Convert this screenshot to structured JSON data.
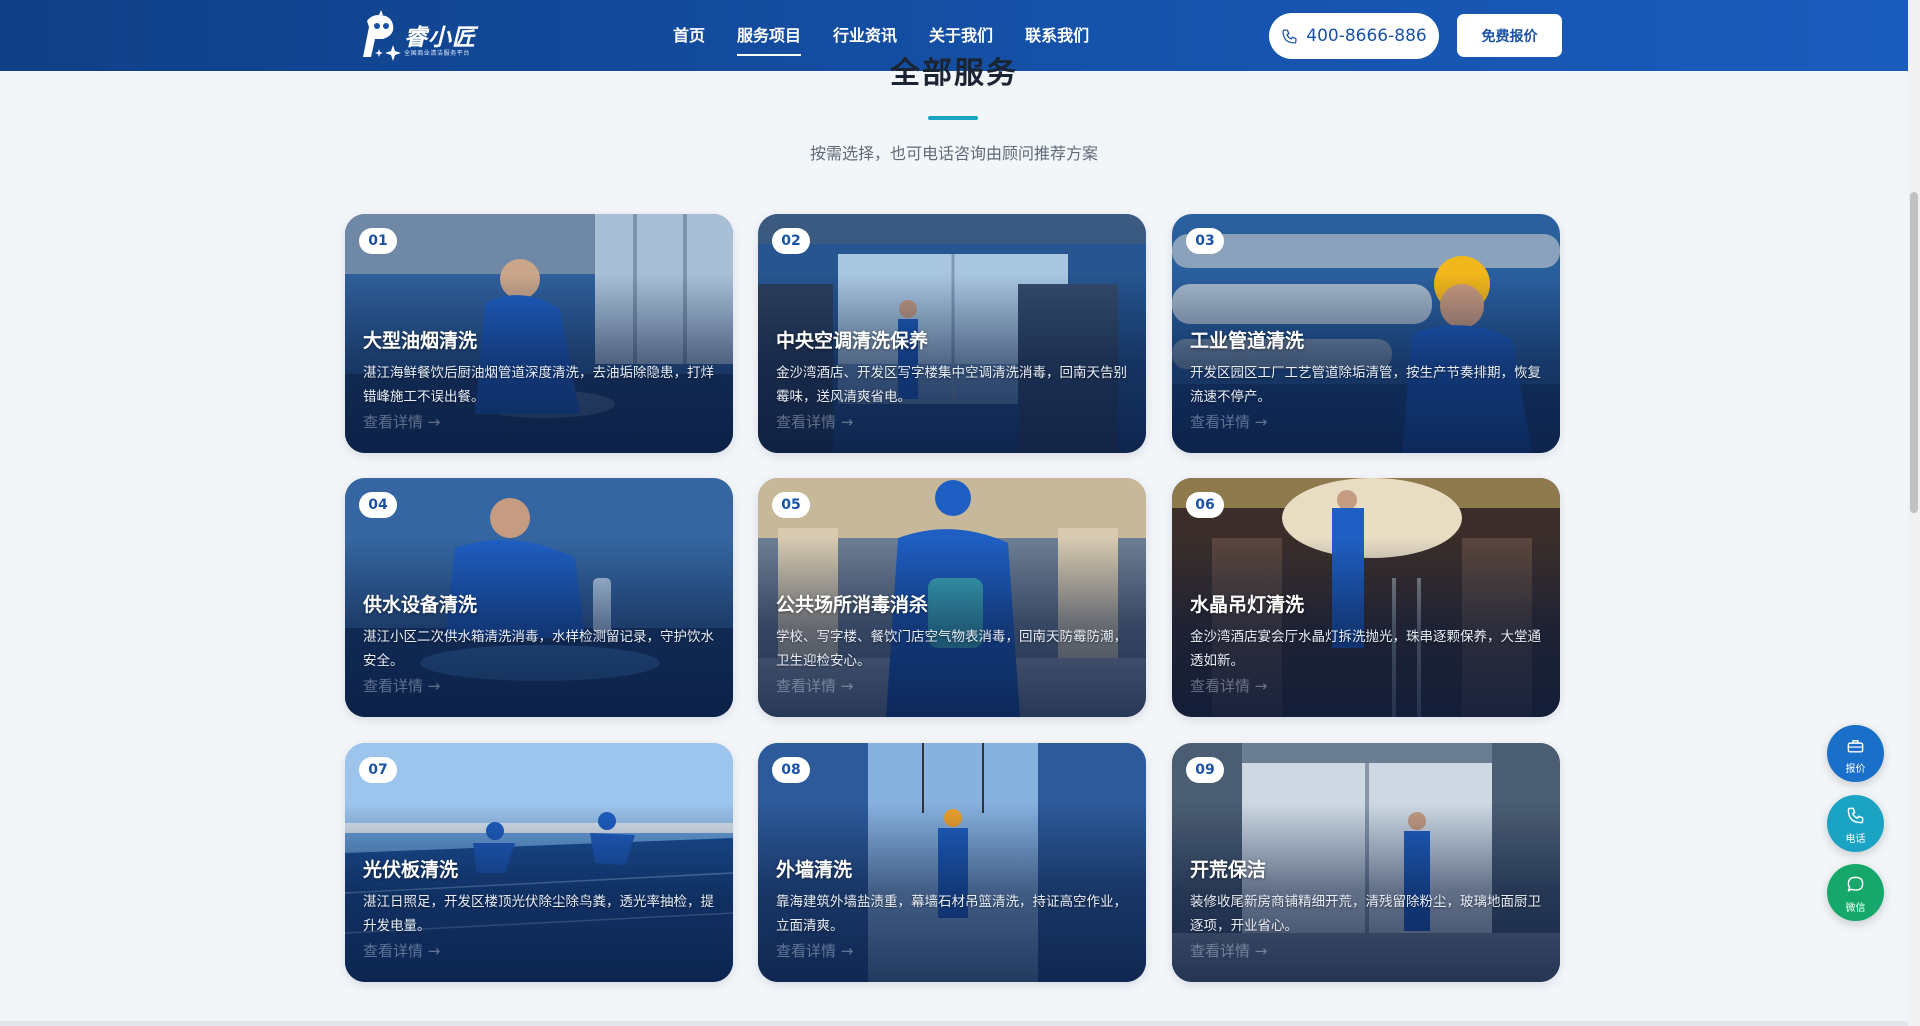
{
  "header": {
    "logo_text": "睿小匠",
    "logo_subtitle": "全国商业清洁服务平台",
    "nav": [
      {
        "label": "首页",
        "active": false
      },
      {
        "label": "服务项目",
        "active": true
      },
      {
        "label": "行业资讯",
        "active": false
      },
      {
        "label": "关于我们",
        "active": false
      },
      {
        "label": "联系我们",
        "active": false
      }
    ],
    "phone": "400-8666-886",
    "quote_label": "免费报价"
  },
  "section": {
    "title": "全部服务",
    "subtitle": "按需选择，也可电话咨询由顾问推荐方案"
  },
  "cards": [
    {
      "num": "01",
      "title": "大型油烟清洗",
      "desc": "湛江海鲜餐饮后厨油烟管道深度清洗，去油垢除隐患，打烊错峰施工不误出餐。",
      "more": "查看详情 →",
      "scene": "kitchen"
    },
    {
      "num": "02",
      "title": "中央空调清洗保养",
      "desc": "金沙湾酒店、开发区写字楼集中空调清洗消毒，回南天告别霉味，送风清爽省电。",
      "more": "查看详情 →",
      "scene": "hvac"
    },
    {
      "num": "03",
      "title": "工业管道清洗",
      "desc": "开发区园区工厂工艺管道除垢清管，按生产节奏排期，恢复流速不停产。",
      "more": "查看详情 →",
      "scene": "pipes"
    },
    {
      "num": "04",
      "title": "供水设备清洗",
      "desc": "湛江小区二次供水箱清洗消毒，水样检测留记录，守护饮水安全。",
      "more": "查看详情 →",
      "scene": "water"
    },
    {
      "num": "05",
      "title": "公共场所消毒消杀",
      "desc": "学校、写字楼、餐饮门店空气物表消毒，回南天防霉防潮，卫生迎检安心。",
      "more": "查看详情 →",
      "scene": "mall"
    },
    {
      "num": "06",
      "title": "水晶吊灯清洗",
      "desc": "金沙湾酒店宴会厅水晶灯拆洗抛光，珠串逐颗保养，大堂通透如新。",
      "more": "查看详情 →",
      "scene": "chandelier"
    },
    {
      "num": "07",
      "title": "光伏板清洗",
      "desc": "湛江日照足，开发区楼顶光伏除尘除鸟粪，透光率抽检，提升发电量。",
      "more": "查看详情 →",
      "scene": "solar"
    },
    {
      "num": "08",
      "title": "外墙清洗",
      "desc": "靠海建筑外墙盐渍重，幕墙石材吊篮清洗，持证高空作业，立面清爽。",
      "more": "查看详情 →",
      "scene": "facade"
    },
    {
      "num": "09",
      "title": "开荒保洁",
      "desc": "装修收尾新房商铺精细开荒，清残留除粉尘，玻璃地面厨卫逐项，开业省心。",
      "more": "查看详情 →",
      "scene": "room"
    }
  ],
  "float_buttons": [
    {
      "label": "报价",
      "icon": "briefcase-icon",
      "color": "#1a6fc9"
    },
    {
      "label": "电话",
      "icon": "phone-icon",
      "color": "#1aa3c2"
    },
    {
      "label": "微信",
      "icon": "chat-icon",
      "color": "#16a86a"
    }
  ],
  "colors": {
    "header": "#1551a8",
    "accent": "#1aa3c2",
    "card_shade": "#08193c"
  }
}
